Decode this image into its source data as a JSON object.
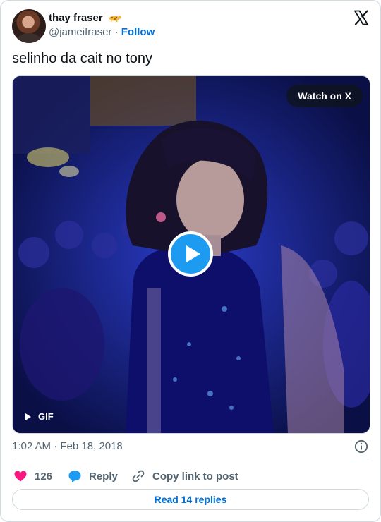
{
  "author": {
    "name": "thay fraser",
    "handle": "@jameifraser",
    "separator": "·",
    "follow_label": "Follow",
    "name_emoji": "leopard-icon"
  },
  "tweet": {
    "text": "selinho da cait no tony",
    "timestamp": "1:02 AM · Feb 18, 2018"
  },
  "media": {
    "type": "gif",
    "watch_label": "Watch on X",
    "gif_label": "GIF",
    "play_icon": "play-icon"
  },
  "actions": {
    "likes_count": "126",
    "reply_label": "Reply",
    "copy_label": "Copy link to post",
    "read_replies_label": "Read 14 replies"
  },
  "colors": {
    "like": "#f91880",
    "reply": "#1d9bf0",
    "link": "#006fd6",
    "secondary_text": "#536471",
    "border": "#cfd9de"
  }
}
